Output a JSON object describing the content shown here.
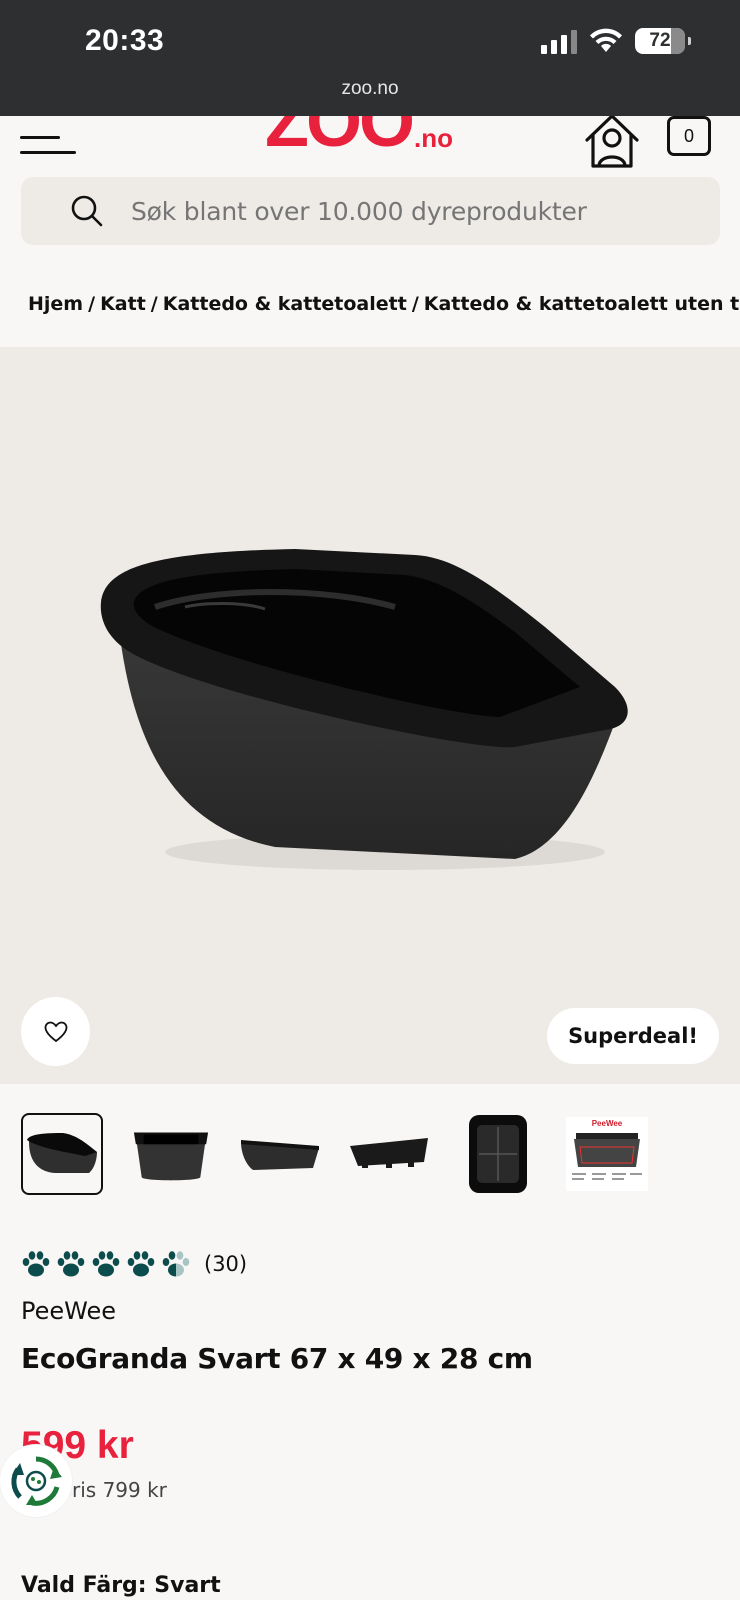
{
  "status_bar": {
    "time": "20:33",
    "battery": "72",
    "url": "zoo.no"
  },
  "header": {
    "logo_main": "ZOO",
    "logo_suffix": ".no",
    "cart_count": "0",
    "brand_color": "#e8213d"
  },
  "search": {
    "placeholder": "Søk blant over 10.000 dyreprodukter"
  },
  "breadcrumb": [
    "Hjem",
    "Katt",
    "Kattedo & kattetoalett",
    "Kattedo & kattetoalett uten tak"
  ],
  "hero": {
    "badge": "Superdeal!"
  },
  "gallery": {
    "thumbnail_count": 6,
    "active_index": 0,
    "thumb_last_text": "PeeWee"
  },
  "product": {
    "rating_paws": 4.5,
    "rating_count": "(30)",
    "brand": "PeeWee",
    "title": "EcoGranda Svart 67 x 49 x 28 cm",
    "price": "599 kr",
    "old_price": "Før pris 799 kr",
    "variant": "Vald Färg: Svart"
  },
  "icons": {
    "menu": "hamburger-icon",
    "account": "user-house-icon",
    "search": "search-icon",
    "wishlist": "heart-icon",
    "rating": "paw-icon",
    "eco": "recycle-eco-icon"
  },
  "colors": {
    "paw": "#0d4c4c",
    "price": "#e8213d"
  }
}
